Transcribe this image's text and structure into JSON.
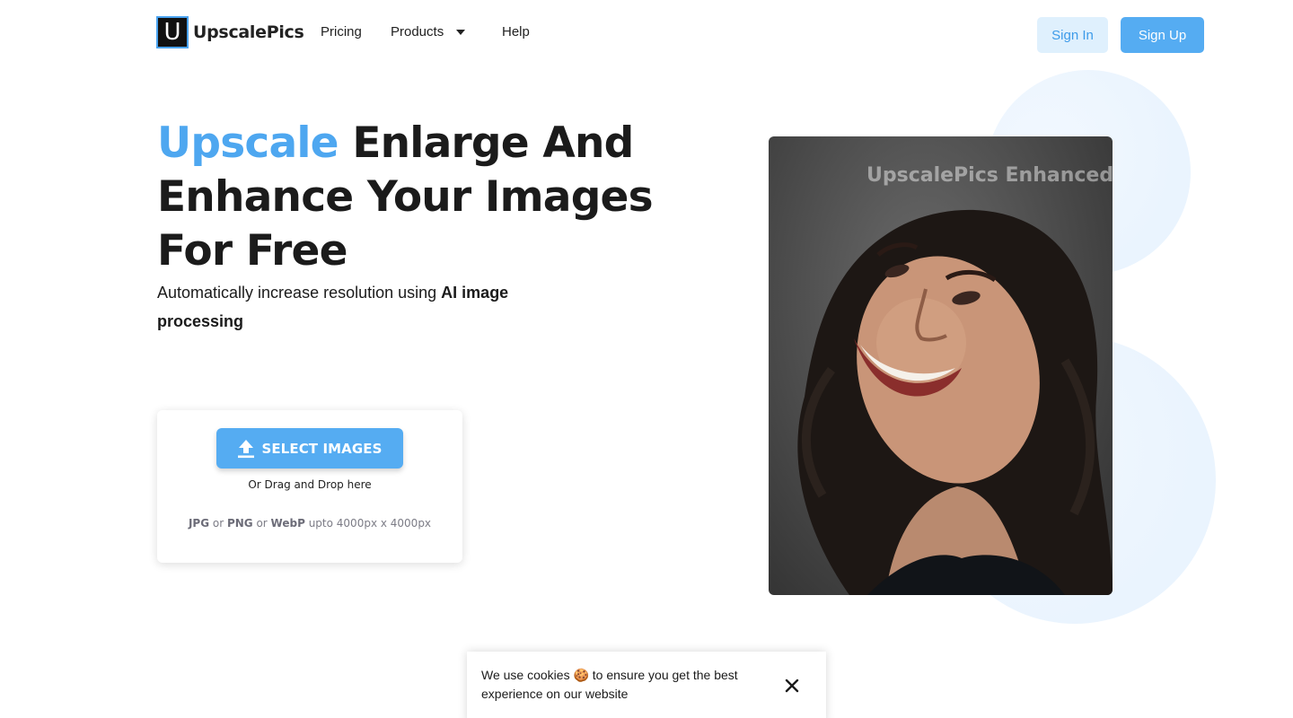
{
  "header": {
    "logo_letter": "U",
    "logo_name": "UpscalePics",
    "nav": {
      "pricing": "Pricing",
      "products": "Products",
      "help": "Help"
    },
    "sign_in": "Sign In",
    "sign_up": "Sign Up"
  },
  "hero": {
    "title_accent": "Upscale",
    "title_rest": " Enlarge And Enhance Your Images For Free",
    "subtitle_plain": "Automatically increase resolution using ",
    "subtitle_bold": "AI image processing"
  },
  "upload": {
    "button_label": "SELECT IMAGES",
    "drag_text": "Or Drag and Drop here",
    "format_1": "JPG",
    "sep_1": " or ",
    "format_2": "PNG",
    "sep_2": " or ",
    "format_3": "WebP",
    "size_limit": " upto 4000px x 4000px"
  },
  "preview": {
    "watermark": "UpscalePics Enhanced"
  },
  "cookie": {
    "text": "We use cookies 🍪 to ensure you get the best experience on our website"
  },
  "colors": {
    "accent": "#4ea7f0",
    "button": "#55acf2",
    "sign_in_bg": "#dff0fd"
  },
  "icons": {
    "products_caret": "caret-down-icon",
    "upload": "upload-icon",
    "cookie_close": "close-icon"
  }
}
